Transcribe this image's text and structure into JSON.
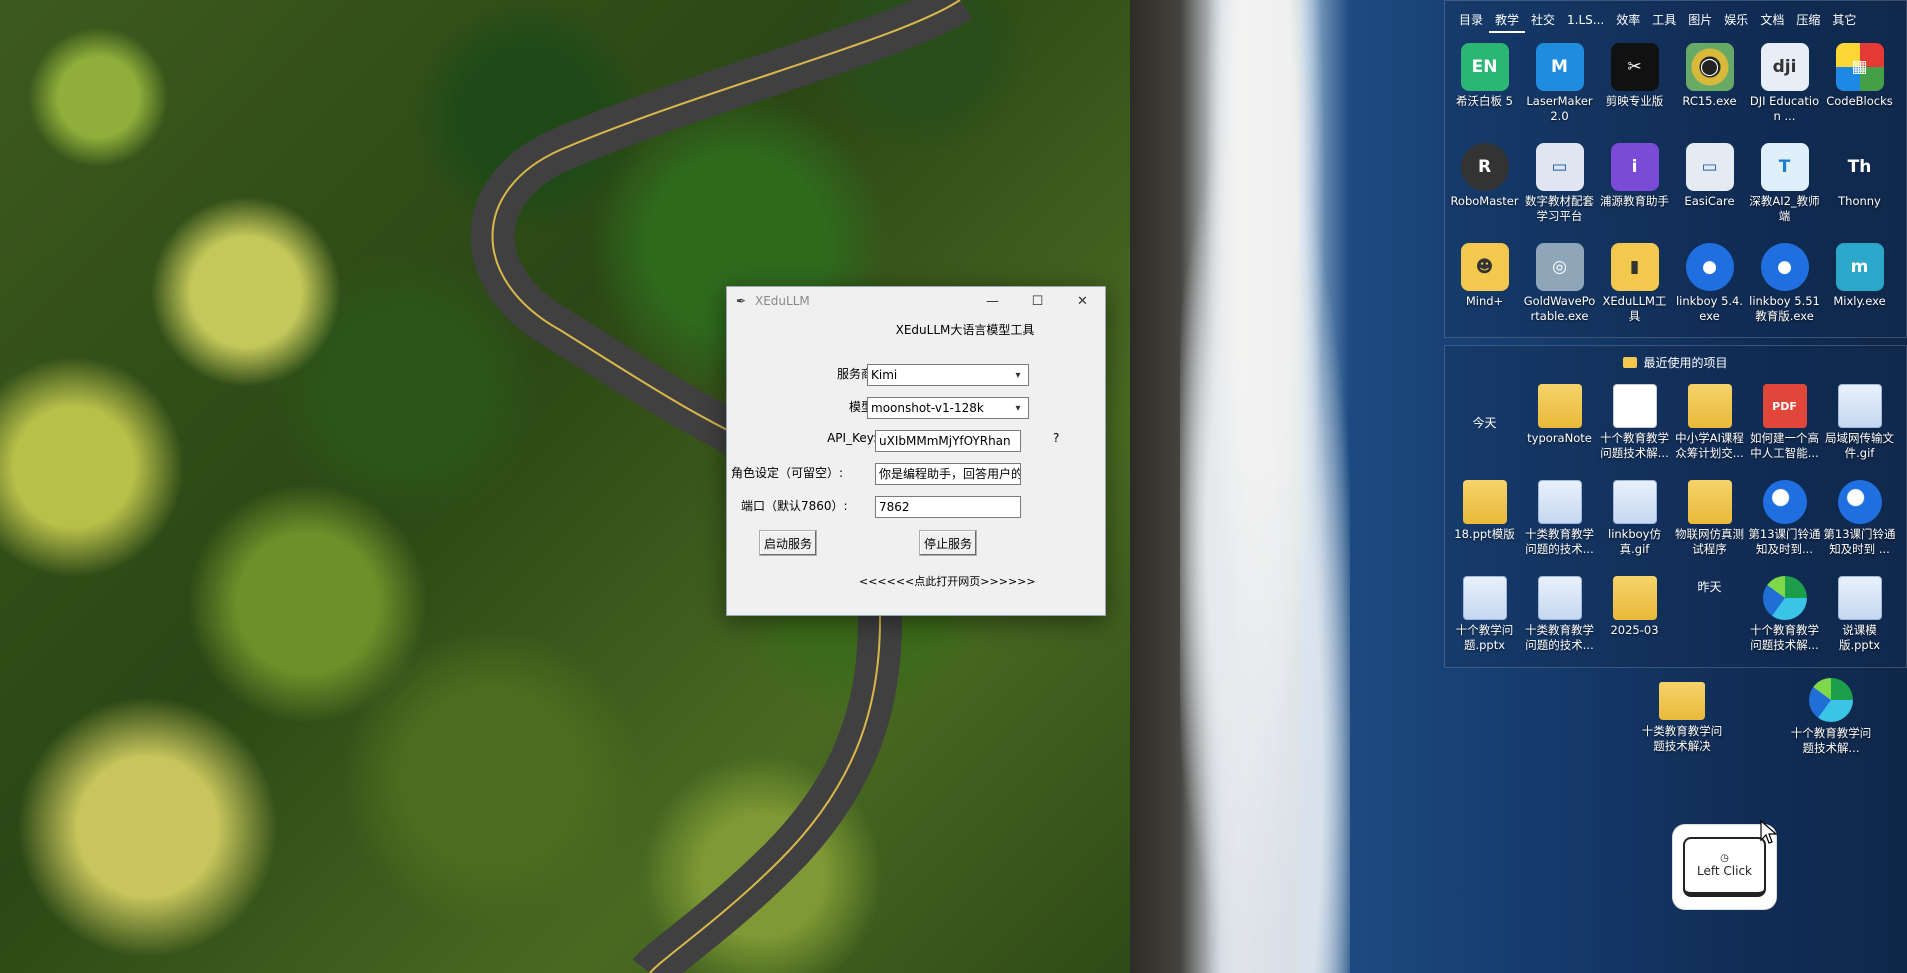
{
  "window": {
    "title": "XEduLLM",
    "heading": "XEduLLM大语言模型工具",
    "provider_label": "服务商:",
    "provider_value": "Kimi",
    "model_label": "模型:",
    "model_value": "moonshot-v1-128k",
    "apikey_label": "API_Key:",
    "apikey_value": "uXIbMMmMjYfOYRhan",
    "help_mark": "?",
    "role_label": "角色设定（可留空）:",
    "role_value": "你是编程助手，回答用户的",
    "port_label": "端口（默认7860）:",
    "port_value": "7862",
    "start_button": "启动服务",
    "stop_button": "停止服务",
    "open_link": "<<<<<<点此打开网页>>>>>>"
  },
  "fence_tabs": [
    "目录",
    "教学",
    "社交",
    "1.LS...",
    "效率",
    "工具",
    "图片",
    "娱乐",
    "文档",
    "压缩",
    "其它"
  ],
  "active_tab": "教学",
  "apps": [
    {
      "label": "希沃白板 5",
      "icon": "EN"
    },
    {
      "label": "LaserMaker 2.0",
      "icon": "M"
    },
    {
      "label": "剪映专业版",
      "icon": "✂"
    },
    {
      "label": "RC15.exe",
      "icon": "◯"
    },
    {
      "label": "DJI Education ...",
      "icon": "dji"
    },
    {
      "label": "CodeBlocks",
      "icon": "▦"
    },
    {
      "label": "RoboMaster",
      "icon": "R"
    },
    {
      "label": "数字教材配套学习平台",
      "icon": "▭"
    },
    {
      "label": "浦源教育助手",
      "icon": "i"
    },
    {
      "label": "EasiCare",
      "icon": "▭"
    },
    {
      "label": "深教AI2_教师端",
      "icon": "T"
    },
    {
      "label": "Thonny",
      "icon": "Th"
    },
    {
      "label": "Mind+",
      "icon": "☻"
    },
    {
      "label": "GoldWavePortable.exe",
      "icon": "◎"
    },
    {
      "label": "XEduLLM工具",
      "icon": "▮"
    },
    {
      "label": "linkboy 5.4.exe",
      "icon": "●"
    },
    {
      "label": "linkboy 5.51教育版.exe",
      "icon": "●"
    },
    {
      "label": "Mixly.exe",
      "icon": "m"
    }
  ],
  "recent": {
    "title": "最近使用的项目",
    "today": "今天",
    "yesterday": "昨天",
    "today_items": [
      {
        "label": "typoraNote",
        "kind": "folder"
      },
      {
        "label": "十个教育教学问题技术解...",
        "kind": "doc"
      },
      {
        "label": "中小学AI课程众筹计划交...",
        "kind": "folder"
      },
      {
        "label": "如何建一个高中人工智能...",
        "kind": "pdf"
      },
      {
        "label": "局域网传输文件.gif",
        "kind": "slide"
      },
      {
        "label": "18.ppt模版",
        "kind": "folder"
      },
      {
        "label": "十类教育教学问题的技术...",
        "kind": "slide"
      },
      {
        "label": "linkboy仿真.gif",
        "kind": "slide"
      },
      {
        "label": "物联网仿真测试程序",
        "kind": "folder"
      },
      {
        "label": "第13课门铃通知及时到...",
        "kind": "orb"
      },
      {
        "label": "第13课门铃通知及时到 ...",
        "kind": "orb"
      }
    ],
    "yesterday_items": [
      {
        "label": "十个教学问题.pptx",
        "kind": "slide"
      },
      {
        "label": "十类教育教学问题的技术...",
        "kind": "slide"
      },
      {
        "label": "2025-03",
        "kind": "folder"
      },
      {
        "label": "十个教育教学问题技术解...",
        "kind": "edge"
      },
      {
        "label": "说课模版.pptx",
        "kind": "slide"
      }
    ]
  },
  "desktop": {
    "folder_label": "十类教育教学问题技术解决",
    "edge_label": "十个教育教学问题技术解..."
  },
  "click_badge": "Left Click"
}
